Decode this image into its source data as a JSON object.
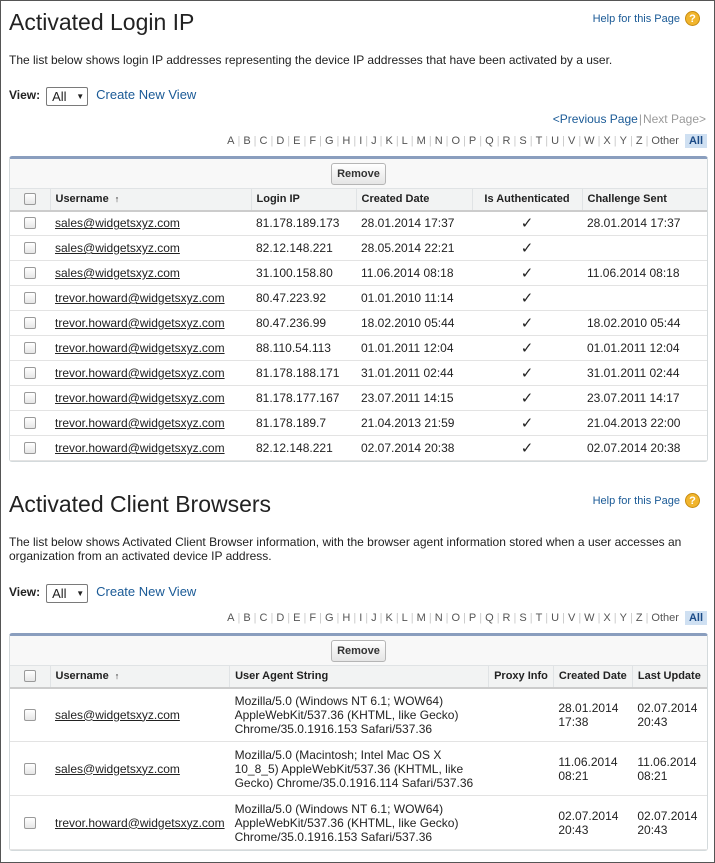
{
  "ip_section": {
    "title": "Activated Login IP",
    "help_label": "Help for this Page",
    "description": "The list below shows login IP addresses representing the device IP addresses that have been activated by a user.",
    "view_label": "View:",
    "view_value": "All",
    "create_view": "Create New View",
    "prev_page": "<Previous Page",
    "next_page": "Next Page>",
    "remove_label": "Remove",
    "columns": [
      "Username",
      "Login IP",
      "Created Date",
      "Is Authenticated",
      "Challenge Sent"
    ],
    "rows": [
      {
        "user": "sales@widgetsxyz.com",
        "ip": "81.178.189.173",
        "created": "28.01.2014 17:37",
        "auth": "✓",
        "challenge": "28.01.2014 17:37"
      },
      {
        "user": "sales@widgetsxyz.com",
        "ip": "82.12.148.221",
        "created": "28.05.2014 22:21",
        "auth": "✓",
        "challenge": ""
      },
      {
        "user": "sales@widgetsxyz.com",
        "ip": "31.100.158.80",
        "created": "11.06.2014 08:18",
        "auth": "✓",
        "challenge": "11.06.2014 08:18"
      },
      {
        "user": "trevor.howard@widgetsxyz.com",
        "ip": "80.47.223.92",
        "created": "01.01.2010 11:14",
        "auth": "✓",
        "challenge": ""
      },
      {
        "user": "trevor.howard@widgetsxyz.com",
        "ip": "80.47.236.99",
        "created": "18.02.2010 05:44",
        "auth": "✓",
        "challenge": "18.02.2010 05:44"
      },
      {
        "user": "trevor.howard@widgetsxyz.com",
        "ip": "88.110.54.113",
        "created": "01.01.2011 12:04",
        "auth": "✓",
        "challenge": "01.01.2011 12:04"
      },
      {
        "user": "trevor.howard@widgetsxyz.com",
        "ip": "81.178.188.171",
        "created": "31.01.2011 02:44",
        "auth": "✓",
        "challenge": "31.01.2011 02:44"
      },
      {
        "user": "trevor.howard@widgetsxyz.com",
        "ip": "81.178.177.167",
        "created": "23.07.2011 14:15",
        "auth": "✓",
        "challenge": "23.07.2011 14:17"
      },
      {
        "user": "trevor.howard@widgetsxyz.com",
        "ip": "81.178.189.7",
        "created": "21.04.2013 21:59",
        "auth": "✓",
        "challenge": "21.04.2013 22:00"
      },
      {
        "user": "trevor.howard@widgetsxyz.com",
        "ip": "82.12.148.221",
        "created": "02.07.2014 20:38",
        "auth": "✓",
        "challenge": "02.07.2014 20:38"
      }
    ]
  },
  "browser_section": {
    "title": "Activated Client Browsers",
    "help_label": "Help for this Page",
    "description": "The list below shows Activated Client Browser information, with the browser agent information stored when a user accesses an organization from an activated device IP address.",
    "view_label": "View:",
    "view_value": "All",
    "create_view": "Create New View",
    "remove_label": "Remove",
    "columns": [
      "Username",
      "User Agent String",
      "Proxy Info",
      "Created Date",
      "Last Update"
    ],
    "rows": [
      {
        "user": "sales@widgetsxyz.com",
        "agent": "Mozilla/5.0 (Windows NT 6.1; WOW64) AppleWebKit/537.36 (KHTML, like Gecko) Chrome/35.0.1916.153 Safari/537.36",
        "proxy": "",
        "created": "28.01.2014 17:38",
        "updated": "02.07.2014 20:43"
      },
      {
        "user": "sales@widgetsxyz.com",
        "agent": "Mozilla/5.0 (Macintosh; Intel Mac OS X 10_8_5) AppleWebKit/537.36 (KHTML, like Gecko) Chrome/35.0.1916.114 Safari/537.36",
        "proxy": "",
        "created": "11.06.2014 08:21",
        "updated": "11.06.2014 08:21"
      },
      {
        "user": "trevor.howard@widgetsxyz.com",
        "agent": "Mozilla/5.0 (Windows NT 6.1; WOW64) AppleWebKit/537.36 (KHTML, like Gecko) Chrome/35.0.1916.153 Safari/537.36",
        "proxy": "",
        "created": "02.07.2014 20:43",
        "updated": "02.07.2014 20:43"
      }
    ]
  },
  "alphabet": [
    "A",
    "B",
    "C",
    "D",
    "E",
    "F",
    "G",
    "H",
    "I",
    "J",
    "K",
    "L",
    "M",
    "N",
    "O",
    "P",
    "Q",
    "R",
    "S",
    "T",
    "U",
    "V",
    "W",
    "X",
    "Y",
    "Z",
    "Other",
    "All"
  ],
  "icons": {
    "help": "?",
    "sort": "↑",
    "caret": "▼"
  },
  "colors": {
    "link": "#1a5a96",
    "table_border": "#8a9ebe",
    "help_icon": "#f1b52d",
    "alpha_active_bg": "#cfe0f2"
  }
}
